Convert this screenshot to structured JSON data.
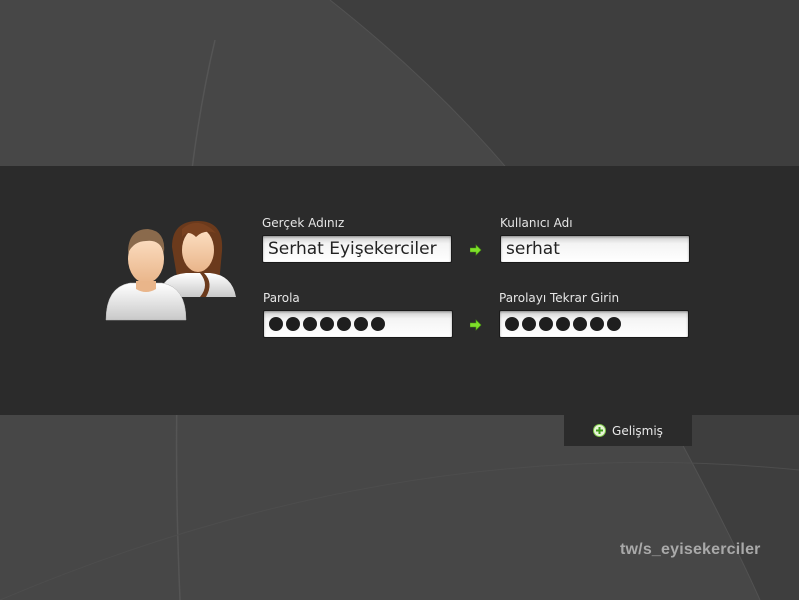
{
  "form": {
    "real_name": {
      "label": "Gerçek Adınız",
      "value": "Serhat Eyişekerciler"
    },
    "username": {
      "label": "Kullanıcı Adı",
      "value": "serhat"
    },
    "password": {
      "label": "Parola",
      "mask_length": 7
    },
    "password_repeat": {
      "label": "Parolayı Tekrar Girin",
      "mask_length": 7
    }
  },
  "advanced_tab": {
    "label": "Gelişmiş",
    "icon": "plus-circle-icon"
  },
  "watermark": "tw/s_eyisekerciler",
  "icons": {
    "arrow": "arrow-right-icon",
    "users": "users-icon"
  },
  "colors": {
    "band": "#2b2b2b",
    "background": "#474747",
    "accent": "#7fe02a"
  }
}
